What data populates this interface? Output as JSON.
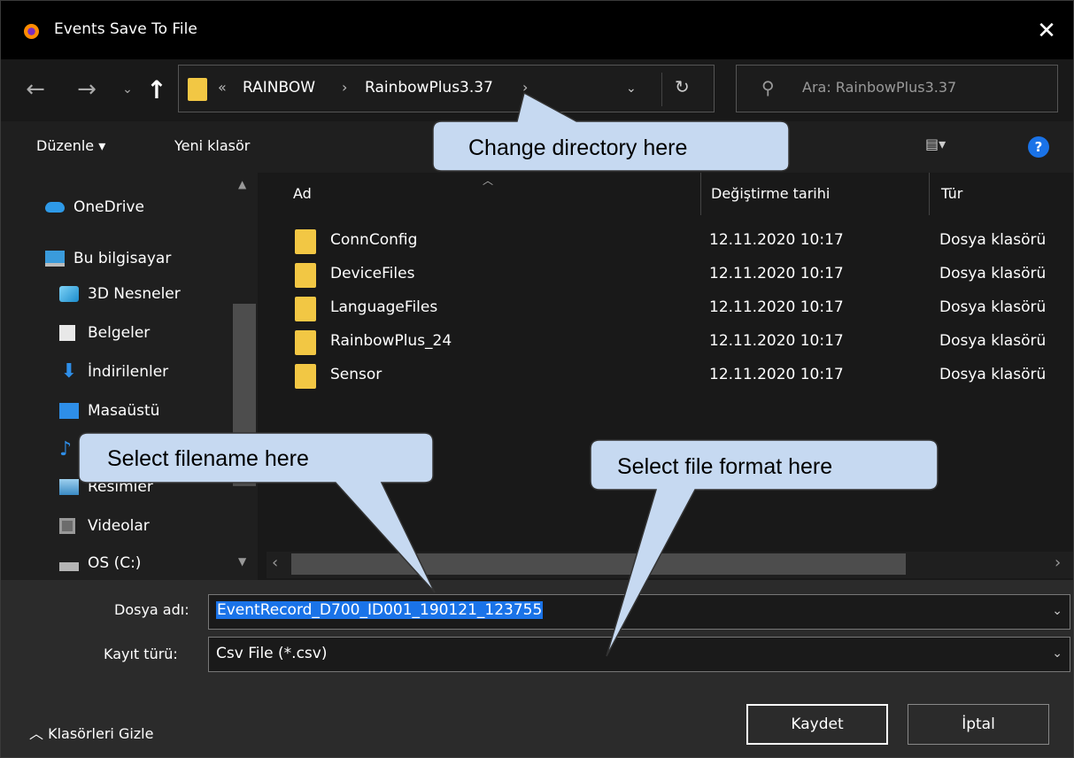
{
  "window": {
    "title": "Events Save To File",
    "close_label": "✕"
  },
  "nav": {
    "back": "←",
    "forward": "→",
    "recent": "⌄",
    "up": "↑"
  },
  "address": {
    "sep_prefix": "«",
    "crumbs": [
      "RAINBOW",
      "RainbowPlus3.37"
    ],
    "sep": "›"
  },
  "search": {
    "placeholder": "Ara: RainbowPlus3.37"
  },
  "toolbar": {
    "organize": "Düzenle ▾",
    "new_folder": "Yeni klasör",
    "help": "?"
  },
  "sidebar": {
    "items": [
      {
        "label": "OneDrive",
        "icon": "cloud-icon"
      },
      {
        "label": "Bu bilgisayar",
        "icon": "computer-icon"
      },
      {
        "label": "3D Nesneler",
        "icon": "cube-icon"
      },
      {
        "label": "Belgeler",
        "icon": "document-icon"
      },
      {
        "label": "İndirilenler",
        "icon": "download-icon"
      },
      {
        "label": "Masaüstü",
        "icon": "desktop-icon"
      },
      {
        "label": "Müzik",
        "icon": "music-icon"
      },
      {
        "label": "Resimler",
        "icon": "pictures-icon"
      },
      {
        "label": "Videolar",
        "icon": "video-icon"
      },
      {
        "label": "OS (C:)",
        "icon": "drive-icon"
      }
    ]
  },
  "columns": {
    "name": "Ad",
    "date": "Değiştirme tarihi",
    "type": "Tür"
  },
  "files": [
    {
      "name": "ConnConfig",
      "date": "12.11.2020 10:17",
      "type": "Dosya klasörü"
    },
    {
      "name": "DeviceFiles",
      "date": "12.11.2020 10:17",
      "type": "Dosya klasörü"
    },
    {
      "name": "LanguageFiles",
      "date": "12.11.2020 10:17",
      "type": "Dosya klasörü"
    },
    {
      "name": "RainbowPlus_24",
      "date": "12.11.2020 10:17",
      "type": "Dosya klasörü"
    },
    {
      "name": "Sensor",
      "date": "12.11.2020 10:17",
      "type": "Dosya klasörü"
    }
  ],
  "form": {
    "filename_label": "Dosya adı:",
    "filename_value": "EventRecord_D700_ID001_190121_123755",
    "filetype_label": "Kayıt türü:",
    "filetype_value": "Csv File (*.csv)"
  },
  "footer": {
    "hide_folders": "Klasörleri Gizle",
    "save": "Kaydet",
    "cancel": "İptal"
  },
  "callouts": {
    "directory": "Change directory here",
    "filename": "Select filename here",
    "format": "Select file format here",
    "fill": "#c6d9f1"
  }
}
